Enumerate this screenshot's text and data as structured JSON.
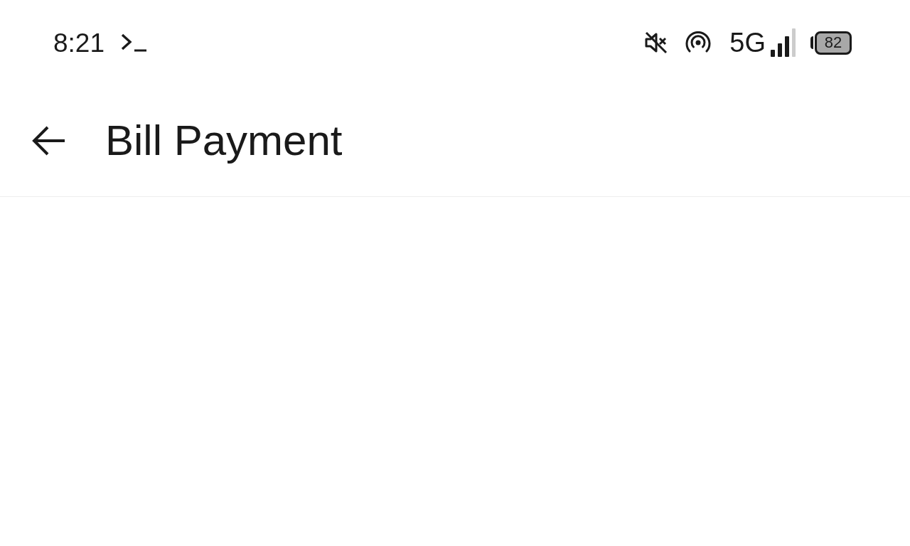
{
  "status_bar": {
    "time": "8:21",
    "network": "5G",
    "battery": "82"
  },
  "app_bar": {
    "title": "Bill Payment"
  }
}
